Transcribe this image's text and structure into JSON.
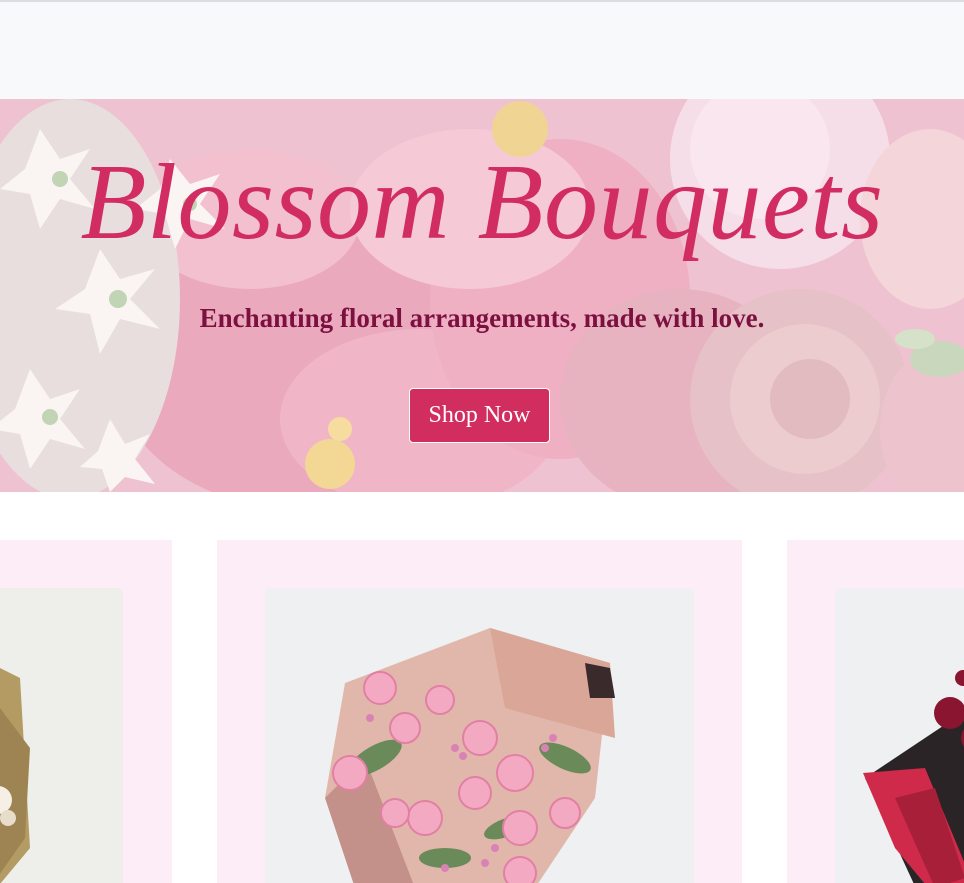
{
  "hero": {
    "title": "Blossom Bouquets",
    "subtitle": "Enchanting floral arrangements, made with love.",
    "cta_label": "Shop Now"
  },
  "products": [
    {
      "image": "flower-bouquet-kraft-wrap-image"
    },
    {
      "image": "pink-rose-bouquet-image"
    },
    {
      "image": "red-flower-bouquet-image"
    }
  ],
  "colors": {
    "accent": "#d12d5f",
    "subtitle": "#7c1140",
    "card_background": "#fcedf6",
    "header_background": "#f8f9fa"
  }
}
